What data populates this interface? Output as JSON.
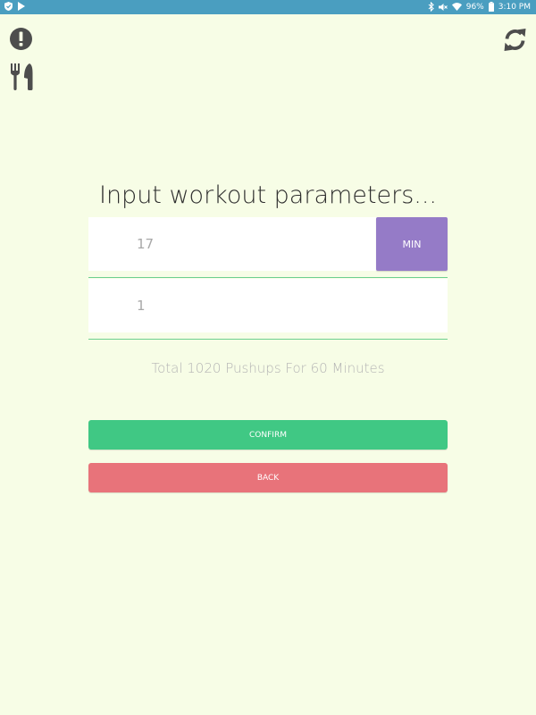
{
  "status_bar": {
    "battery": "96%",
    "time": "3:10 PM",
    "icons": [
      "shield-icon",
      "play-store-icon",
      "bluetooth-icon",
      "mute-icon",
      "wifi-icon",
      "battery-icon"
    ]
  },
  "toolbar": {
    "left_icons": [
      "alert-icon",
      "fork-knife-icon"
    ],
    "right_icons": [
      "refresh-icon"
    ]
  },
  "form": {
    "heading": "Input workout parameters...",
    "count_value": "17",
    "unit_button_label": "MIN",
    "interval_value": "1",
    "summary_text": "Total 1020 Pushups For 60 Minutes",
    "confirm_label": "CONFIRM",
    "back_label": "BACK"
  },
  "colors": {
    "status_bar": "#4a9ec0",
    "background": "#f7fde6",
    "unit_button": "#957bc7",
    "confirm": "#40c884",
    "back": "#e8737a",
    "underline": "#6dcf8e",
    "icon": "#4d4d4d"
  }
}
